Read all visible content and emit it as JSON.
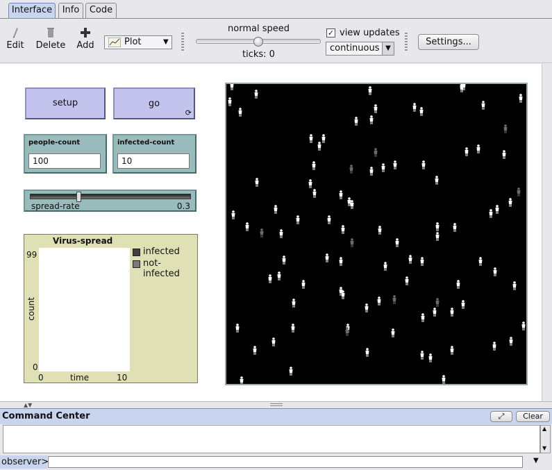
{
  "tabs": [
    "Interface",
    "Info",
    "Code"
  ],
  "toolbar": {
    "edit_label": "Edit",
    "delete_label": "Delete",
    "add_label": "Add",
    "widget_type": "Plot",
    "speed_label": "normal speed",
    "speed_value": 0.5,
    "ticks_label": "ticks: 0",
    "view_updates_label": "view updates",
    "view_updates_checked": true,
    "update_mode": "continuous",
    "settings_label": "Settings..."
  },
  "widgets": {
    "setup_label": "setup",
    "go_label": "go",
    "people_count": {
      "label": "people-count",
      "value": "100"
    },
    "infected_count": {
      "label": "infected-count",
      "value": "10"
    },
    "spread_rate": {
      "label": "spread-rate",
      "value": "0.3",
      "fraction": 0.3
    }
  },
  "plot": {
    "title": "Virus-spread",
    "ymax": "99",
    "ymin": "0",
    "xmin": "0",
    "xmax": "10",
    "xlabel": "time",
    "ylabel": "count",
    "legend": [
      {
        "name": "infected",
        "color": "#404040"
      },
      {
        "name": "not-infected",
        "color": "#7a7a7a"
      }
    ]
  },
  "world": {
    "background": "#000000",
    "healthy_color": "#ffffff",
    "infected_color": "#6b6b6b",
    "agent_icon": "person-icon",
    "people": [
      [
        8,
        2,
        0
      ],
      [
        43,
        14,
        0
      ],
      [
        207,
        9,
        0
      ],
      [
        339,
        3,
        0
      ],
      [
        339,
        5,
        0
      ],
      [
        5,
        25,
        0
      ],
      [
        20,
        40,
        0
      ],
      [
        215,
        35,
        0
      ],
      [
        271,
        33,
        0
      ],
      [
        281,
        39,
        0
      ],
      [
        370,
        30,
        0
      ],
      [
        424,
        20,
        0
      ],
      [
        209,
        51,
        0
      ],
      [
        187,
        53,
        0
      ],
      [
        402,
        64,
        1
      ],
      [
        122,
        78,
        0
      ],
      [
        140,
        78,
        0
      ],
      [
        134,
        89,
        0
      ],
      [
        363,
        93,
        0
      ],
      [
        346,
        97,
        0
      ],
      [
        400,
        101,
        0
      ],
      [
        215,
        98,
        1
      ],
      [
        180,
        122,
        1
      ],
      [
        126,
        117,
        0
      ],
      [
        209,
        125,
        0
      ],
      [
        226,
        120,
        0
      ],
      [
        243,
        116,
        0
      ],
      [
        284,
        116,
        0
      ],
      [
        303,
        138,
        0
      ],
      [
        44,
        141,
        0
      ],
      [
        121,
        143,
        0
      ],
      [
        127,
        157,
        0
      ],
      [
        165,
        159,
        0
      ],
      [
        177,
        169,
        0
      ],
      [
        181,
        173,
        0
      ],
      [
        421,
        155,
        1
      ],
      [
        409,
        170,
        0
      ],
      [
        390,
        180,
        0
      ],
      [
        381,
        186,
        0
      ],
      [
        71,
        180,
        0
      ],
      [
        10,
        188,
        0
      ],
      [
        103,
        195,
        0
      ],
      [
        148,
        195,
        0
      ],
      [
        30,
        205,
        0
      ],
      [
        168,
        209,
        0
      ],
      [
        221,
        210,
        0
      ],
      [
        304,
        205,
        0
      ],
      [
        329,
        206,
        0
      ],
      [
        304,
        219,
        0
      ],
      [
        51,
        214,
        1
      ],
      [
        79,
        215,
        0
      ],
      [
        181,
        228,
        1
      ],
      [
        246,
        228,
        0
      ],
      [
        145,
        250,
        0
      ],
      [
        165,
        255,
        0
      ],
      [
        83,
        253,
        0
      ],
      [
        265,
        252,
        0
      ],
      [
        282,
        255,
        0
      ],
      [
        229,
        262,
        0
      ],
      [
        366,
        255,
        0
      ],
      [
        387,
        270,
        0
      ],
      [
        63,
        280,
        0
      ],
      [
        76,
        276,
        0
      ],
      [
        111,
        288,
        0
      ],
      [
        260,
        283,
        0
      ],
      [
        334,
        288,
        0
      ],
      [
        415,
        290,
        0
      ],
      [
        165,
        298,
        0
      ],
      [
        168,
        303,
        0
      ],
      [
        97,
        315,
        0
      ],
      [
        202,
        322,
        0
      ],
      [
        220,
        312,
        0
      ],
      [
        242,
        310,
        1
      ],
      [
        304,
        314,
        1
      ],
      [
        341,
        317,
        0
      ],
      [
        325,
        328,
        0
      ],
      [
        300,
        328,
        0
      ],
      [
        283,
        336,
        0
      ],
      [
        16,
        351,
        0
      ],
      [
        96,
        351,
        0
      ],
      [
        175,
        351,
        0
      ],
      [
        174,
        356,
        1
      ],
      [
        240,
        358,
        0
      ],
      [
        68,
        371,
        0
      ],
      [
        41,
        383,
        0
      ],
      [
        203,
        386,
        0
      ],
      [
        282,
        390,
        0
      ],
      [
        294,
        394,
        0
      ],
      [
        325,
        383,
        0
      ],
      [
        386,
        377,
        0
      ],
      [
        410,
        370,
        0
      ],
      [
        428,
        348,
        0
      ],
      [
        93,
        413,
        0
      ],
      [
        313,
        425,
        0
      ],
      [
        22,
        427,
        0
      ],
      [
        342,
        2,
        0
      ]
    ]
  },
  "command_center": {
    "title": "Command Center",
    "clear_label": "Clear",
    "prompt": "observer>"
  }
}
